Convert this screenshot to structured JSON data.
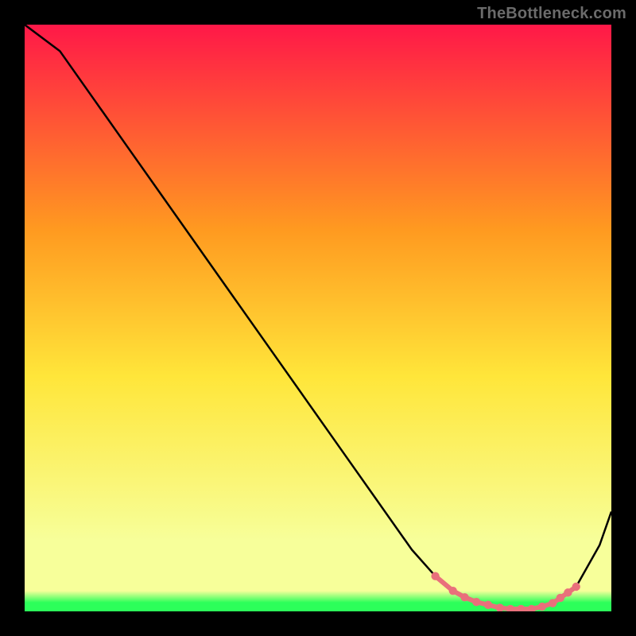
{
  "attribution": "TheBottleneck.com",
  "colors": {
    "frame": "#000000",
    "line": "#000000",
    "marker": "#e9707b",
    "bg_top": "#ff1848",
    "bg_mid_orange": "#ff9a20",
    "bg_mid_yellow": "#ffe63a",
    "bg_pale": "#f7ff9a",
    "bg_green": "#2cff5a",
    "attribution_text": "#6b6b6b"
  },
  "chart_data": {
    "type": "line",
    "title": "",
    "xlabel": "",
    "ylabel": "",
    "xlim": [
      0,
      100
    ],
    "ylim": [
      0,
      100
    ],
    "series": [
      {
        "name": "curve",
        "x": [
          0,
          6,
          12,
          18,
          24,
          30,
          36,
          42,
          48,
          54,
          60,
          66,
          70,
          74,
          78,
          82,
          86,
          90,
          94,
          98,
          100
        ],
        "y": [
          100,
          95.5,
          87,
          78.5,
          70,
          61.5,
          53,
          44.5,
          36,
          27.5,
          19,
          10.5,
          6,
          3,
          1.2,
          0.4,
          0.4,
          1.4,
          4.2,
          11.3,
          17
        ]
      }
    ],
    "markers": {
      "name": "highlight",
      "x": [
        70,
        73,
        75,
        77,
        79,
        81,
        82.8,
        84.6,
        86.4,
        88.2,
        90,
        91.3,
        92.6,
        94
      ],
      "y": [
        6.0,
        3.5,
        2.4,
        1.6,
        1.1,
        0.6,
        0.4,
        0.4,
        0.4,
        0.8,
        1.4,
        2.3,
        3.2,
        4.2
      ]
    }
  }
}
